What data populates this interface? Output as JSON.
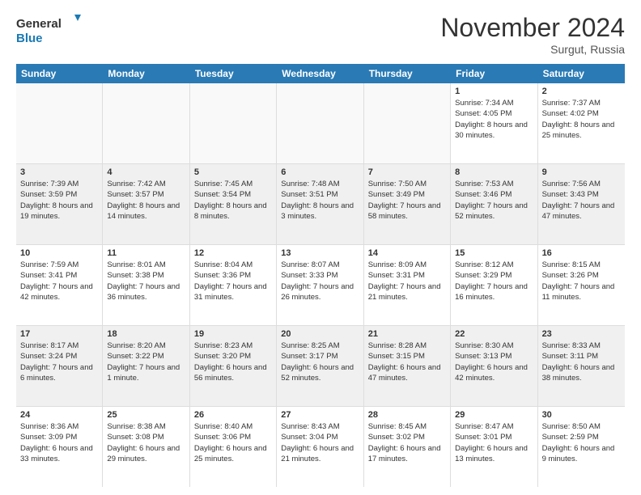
{
  "header": {
    "logo_line1": "General",
    "logo_line2": "Blue",
    "month": "November 2024",
    "location": "Surgut, Russia"
  },
  "days_of_week": [
    "Sunday",
    "Monday",
    "Tuesday",
    "Wednesday",
    "Thursday",
    "Friday",
    "Saturday"
  ],
  "rows": [
    [
      {
        "day": "",
        "info": "",
        "empty": true
      },
      {
        "day": "",
        "info": "",
        "empty": true
      },
      {
        "day": "",
        "info": "",
        "empty": true
      },
      {
        "day": "",
        "info": "",
        "empty": true
      },
      {
        "day": "",
        "info": "",
        "empty": true
      },
      {
        "day": "1",
        "info": "Sunrise: 7:34 AM\nSunset: 4:05 PM\nDaylight: 8 hours and 30 minutes."
      },
      {
        "day": "2",
        "info": "Sunrise: 7:37 AM\nSunset: 4:02 PM\nDaylight: 8 hours and 25 minutes."
      }
    ],
    [
      {
        "day": "3",
        "info": "Sunrise: 7:39 AM\nSunset: 3:59 PM\nDaylight: 8 hours and 19 minutes.",
        "shaded": true
      },
      {
        "day": "4",
        "info": "Sunrise: 7:42 AM\nSunset: 3:57 PM\nDaylight: 8 hours and 14 minutes.",
        "shaded": true
      },
      {
        "day": "5",
        "info": "Sunrise: 7:45 AM\nSunset: 3:54 PM\nDaylight: 8 hours and 8 minutes.",
        "shaded": true
      },
      {
        "day": "6",
        "info": "Sunrise: 7:48 AM\nSunset: 3:51 PM\nDaylight: 8 hours and 3 minutes.",
        "shaded": true
      },
      {
        "day": "7",
        "info": "Sunrise: 7:50 AM\nSunset: 3:49 PM\nDaylight: 7 hours and 58 minutes.",
        "shaded": true
      },
      {
        "day": "8",
        "info": "Sunrise: 7:53 AM\nSunset: 3:46 PM\nDaylight: 7 hours and 52 minutes.",
        "shaded": true
      },
      {
        "day": "9",
        "info": "Sunrise: 7:56 AM\nSunset: 3:43 PM\nDaylight: 7 hours and 47 minutes.",
        "shaded": true
      }
    ],
    [
      {
        "day": "10",
        "info": "Sunrise: 7:59 AM\nSunset: 3:41 PM\nDaylight: 7 hours and 42 minutes."
      },
      {
        "day": "11",
        "info": "Sunrise: 8:01 AM\nSunset: 3:38 PM\nDaylight: 7 hours and 36 minutes."
      },
      {
        "day": "12",
        "info": "Sunrise: 8:04 AM\nSunset: 3:36 PM\nDaylight: 7 hours and 31 minutes."
      },
      {
        "day": "13",
        "info": "Sunrise: 8:07 AM\nSunset: 3:33 PM\nDaylight: 7 hours and 26 minutes."
      },
      {
        "day": "14",
        "info": "Sunrise: 8:09 AM\nSunset: 3:31 PM\nDaylight: 7 hours and 21 minutes."
      },
      {
        "day": "15",
        "info": "Sunrise: 8:12 AM\nSunset: 3:29 PM\nDaylight: 7 hours and 16 minutes."
      },
      {
        "day": "16",
        "info": "Sunrise: 8:15 AM\nSunset: 3:26 PM\nDaylight: 7 hours and 11 minutes."
      }
    ],
    [
      {
        "day": "17",
        "info": "Sunrise: 8:17 AM\nSunset: 3:24 PM\nDaylight: 7 hours and 6 minutes.",
        "shaded": true
      },
      {
        "day": "18",
        "info": "Sunrise: 8:20 AM\nSunset: 3:22 PM\nDaylight: 7 hours and 1 minute.",
        "shaded": true
      },
      {
        "day": "19",
        "info": "Sunrise: 8:23 AM\nSunset: 3:20 PM\nDaylight: 6 hours and 56 minutes.",
        "shaded": true
      },
      {
        "day": "20",
        "info": "Sunrise: 8:25 AM\nSunset: 3:17 PM\nDaylight: 6 hours and 52 minutes.",
        "shaded": true
      },
      {
        "day": "21",
        "info": "Sunrise: 8:28 AM\nSunset: 3:15 PM\nDaylight: 6 hours and 47 minutes.",
        "shaded": true
      },
      {
        "day": "22",
        "info": "Sunrise: 8:30 AM\nSunset: 3:13 PM\nDaylight: 6 hours and 42 minutes.",
        "shaded": true
      },
      {
        "day": "23",
        "info": "Sunrise: 8:33 AM\nSunset: 3:11 PM\nDaylight: 6 hours and 38 minutes.",
        "shaded": true
      }
    ],
    [
      {
        "day": "24",
        "info": "Sunrise: 8:36 AM\nSunset: 3:09 PM\nDaylight: 6 hours and 33 minutes."
      },
      {
        "day": "25",
        "info": "Sunrise: 8:38 AM\nSunset: 3:08 PM\nDaylight: 6 hours and 29 minutes."
      },
      {
        "day": "26",
        "info": "Sunrise: 8:40 AM\nSunset: 3:06 PM\nDaylight: 6 hours and 25 minutes."
      },
      {
        "day": "27",
        "info": "Sunrise: 8:43 AM\nSunset: 3:04 PM\nDaylight: 6 hours and 21 minutes."
      },
      {
        "day": "28",
        "info": "Sunrise: 8:45 AM\nSunset: 3:02 PM\nDaylight: 6 hours and 17 minutes."
      },
      {
        "day": "29",
        "info": "Sunrise: 8:47 AM\nSunset: 3:01 PM\nDaylight: 6 hours and 13 minutes."
      },
      {
        "day": "30",
        "info": "Sunrise: 8:50 AM\nSunset: 2:59 PM\nDaylight: 6 hours and 9 minutes."
      }
    ]
  ]
}
